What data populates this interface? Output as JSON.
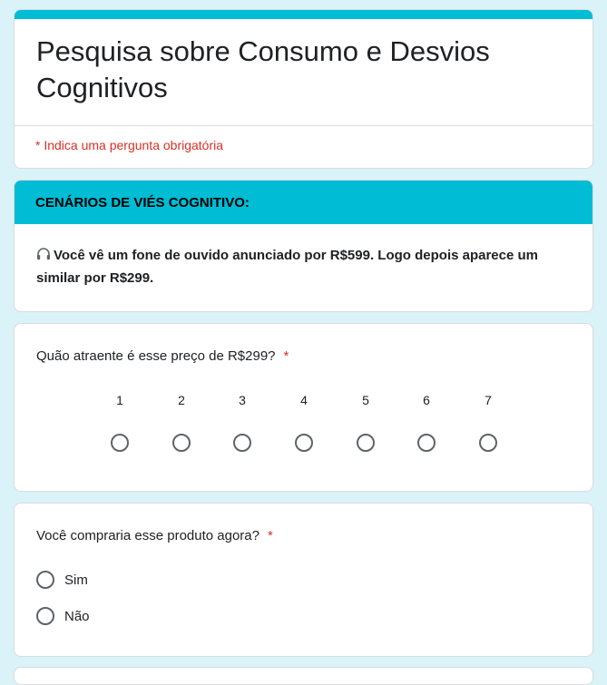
{
  "form": {
    "title": "Pesquisa sobre Consumo e Desvios Cognitivos",
    "required_note": "* Indica uma pergunta obrigatória",
    "accent_color": "#00bcd4",
    "background_color": "#d9f3f8",
    "required_color": "#d93025"
  },
  "section": {
    "header": "CENÁRIOS DE VIÉS COGNITIVO:",
    "icon": "headphones-icon",
    "description": "Você vê um fone de ouvido anunciado por R$599. Logo depois aparece um similar por R$299."
  },
  "questions": [
    {
      "title": "Quão atraente é esse preço de R$299?",
      "required_mark": "*",
      "type": "linear-scale",
      "scale": [
        "1",
        "2",
        "3",
        "4",
        "5",
        "6",
        "7"
      ]
    },
    {
      "title": "Você compraria esse produto agora?",
      "required_mark": "*",
      "type": "multiple-choice",
      "options": [
        "Sim",
        "Não"
      ]
    }
  ]
}
